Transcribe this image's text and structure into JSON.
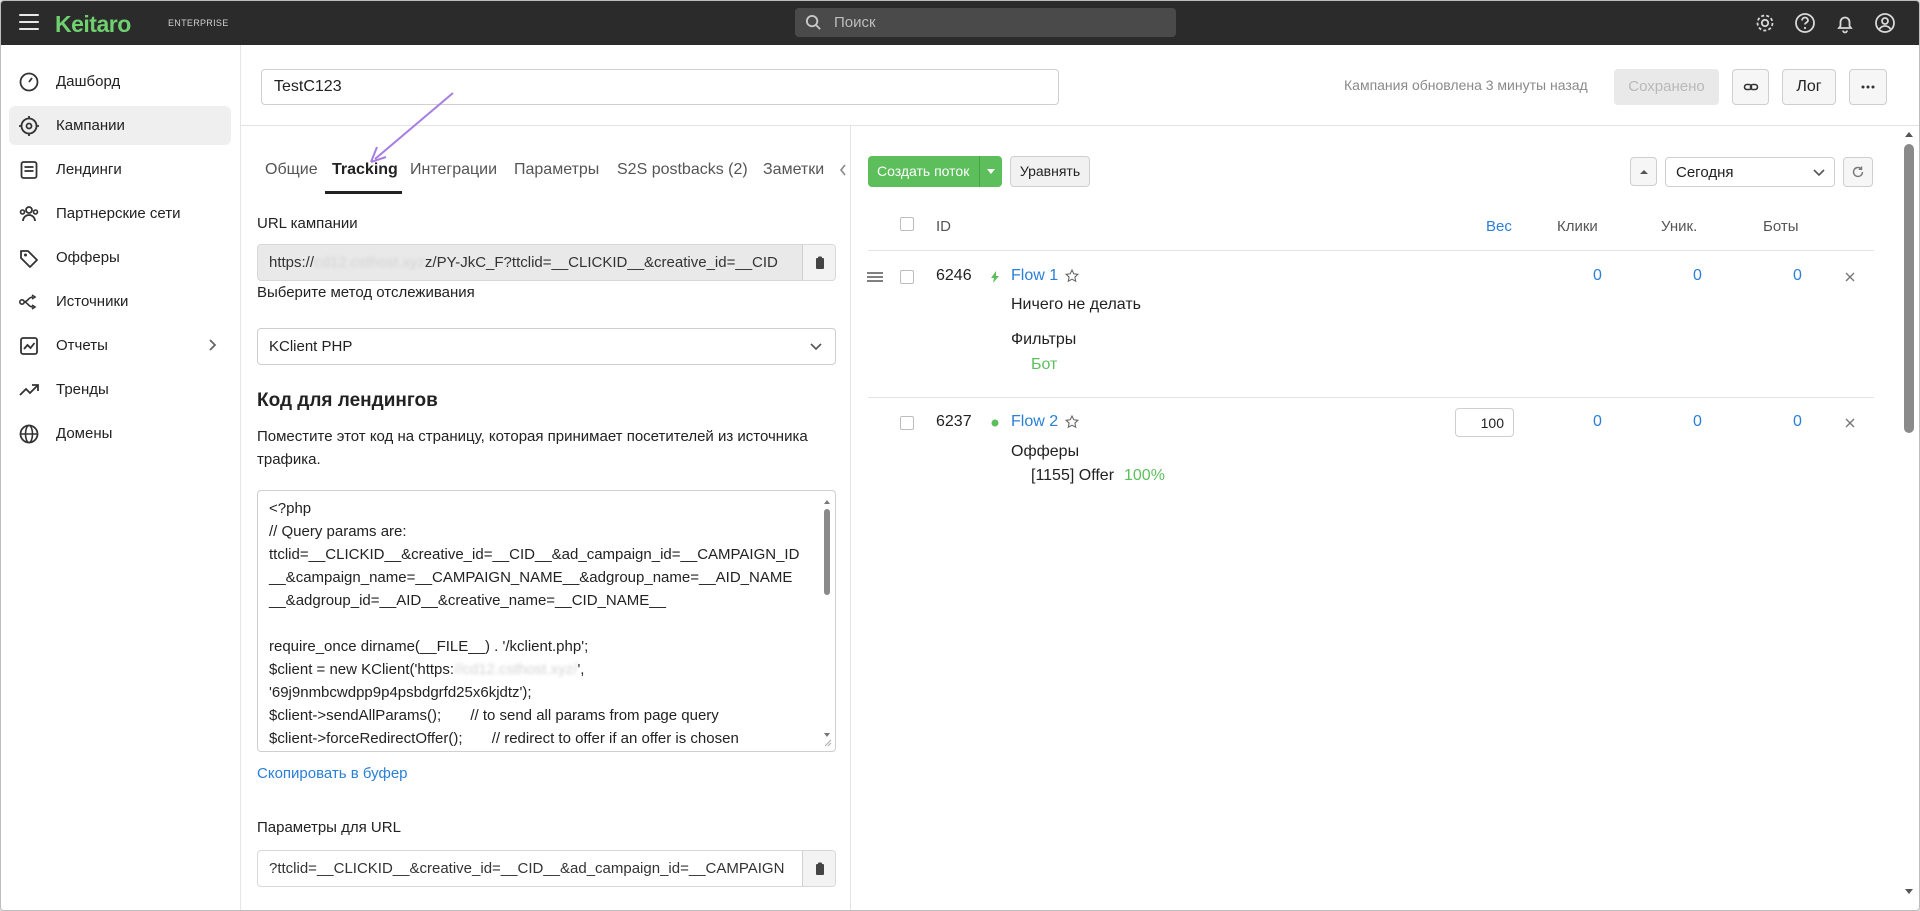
{
  "app": {
    "brand": "Keitaro",
    "edition": "ENTERPRISE",
    "search_placeholder": "Поиск"
  },
  "colors": {
    "topbar": "#2b2b2b",
    "brand_green": "#6fd06f",
    "accent_green": "#5cbf5c",
    "link_blue": "#2a7fd8"
  },
  "sidebar": {
    "items": [
      {
        "label": "Дашборд",
        "icon": "dashboard-icon"
      },
      {
        "label": "Кампании",
        "icon": "target-icon",
        "active": true
      },
      {
        "label": "Лендинги",
        "icon": "landing-icon"
      },
      {
        "label": "Партнерские сети",
        "icon": "network-icon"
      },
      {
        "label": "Офферы",
        "icon": "tag-icon"
      },
      {
        "label": "Источники",
        "icon": "sources-icon"
      },
      {
        "label": "Отчеты",
        "icon": "reports-icon",
        "has_submenu": true
      },
      {
        "label": "Тренды",
        "icon": "trend-icon"
      },
      {
        "label": "Домены",
        "icon": "globe-icon"
      }
    ]
  },
  "header": {
    "campaign_name": "TestC123",
    "updated_text": "Кампания обновлена 3 минуты назад",
    "saved_label": "Сохранено",
    "log_label": "Лог"
  },
  "tabs": [
    "Общие",
    "Tracking",
    "Интеграции",
    "Параметры",
    "S2S postbacks (2)",
    "Заметки"
  ],
  "tracking": {
    "url_label": "URL кампании",
    "url_prefix": "https://",
    "url_blur": "cd12.csthost.xyz",
    "url_suffix": "z/PY-JkC_F?ttclid=__CLICKID__&creative_id=__CID",
    "method_label": "Выберите метод отслеживания",
    "method_value": "KClient PHP",
    "code_title": "Код для лендингов",
    "code_desc": "Поместите этот код на страницу, которая принимает посетителей из источника трафика.",
    "code_lines_a": "<?php\n// Query params are:\nttclid=__CLICKID__&creative_id=__CID__&ad_campaign_id=__CAMPAIGN_ID\n__&campaign_name=__CAMPAIGN_NAME__&adgroup_name=__AID_NAME\n__&adgroup_id=__AID__&creative_name=__CID_NAME__\n\nrequire_once dirname(__FILE__) . '/kclient.php';\n$client = new KClient('https:",
    "code_blur": "//cd12.csthost.xyz/",
    "code_lines_b": "',\n'69j9nmbcwdpp9p4psbdgrfd25x6kjdtz');\n$client->sendAllParams();       // to send all params from page query\n$client->forceRedirectOffer();       // redirect to offer if an offer is chosen",
    "copy_link": "Скопировать в буфер",
    "params_label": "Параметры для URL",
    "params_value": "?ttclid=__CLICKID__&creative_id=__CID__&ad_campaign_id=__CAMPAIGN"
  },
  "flows": {
    "create_label": "Создать поток",
    "align_label": "Уравнять",
    "date_value": "Сегодня",
    "columns": {
      "id": "ID",
      "weight": "Вес",
      "clicks": "Клики",
      "uniq": "Уник.",
      "bots": "Боты"
    },
    "rows": [
      {
        "id": "6246",
        "name": "Flow 1",
        "action": "Ничего не делать",
        "section_label": "Фильтры",
        "filter": "Бот",
        "clicks": "0",
        "uniq": "0",
        "bots": "0"
      },
      {
        "id": "6237",
        "name": "Flow 2",
        "section_label": "Офферы",
        "offer": "[1155] Offer",
        "offer_share": "100%",
        "weight": "100",
        "clicks": "0",
        "uniq": "0",
        "bots": "0"
      }
    ]
  }
}
